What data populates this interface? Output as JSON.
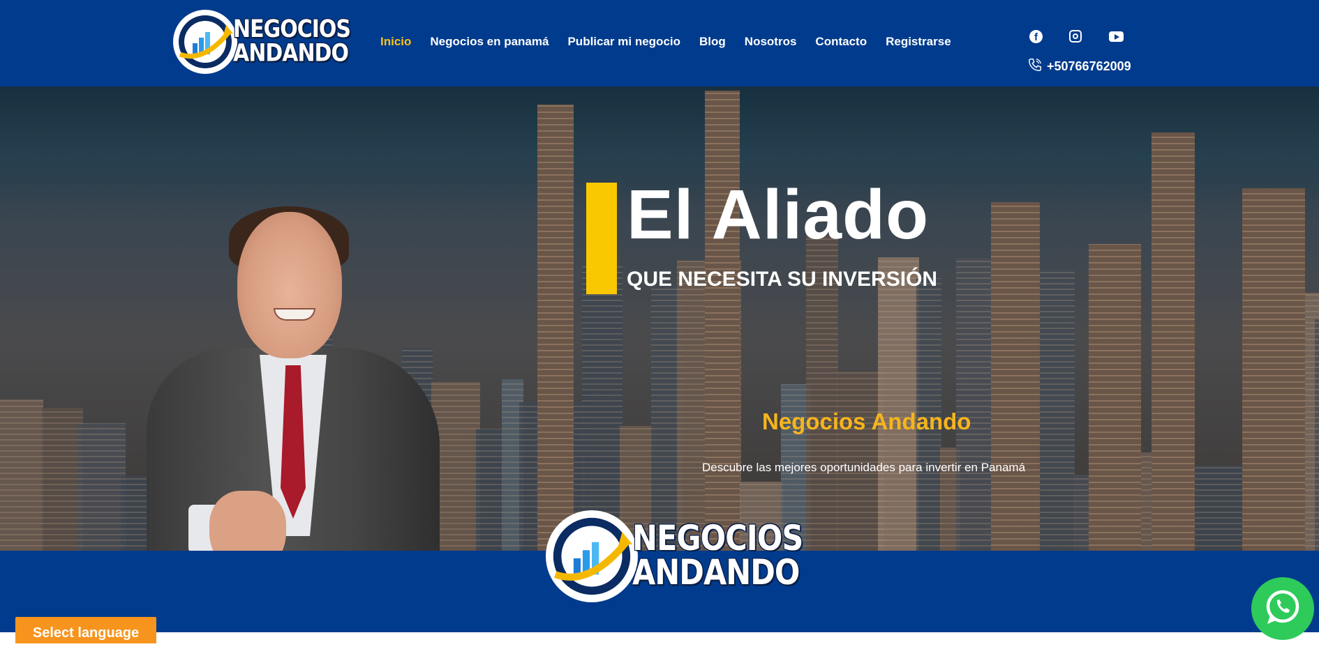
{
  "header": {
    "logo": {
      "line1": "NEGOCIOS",
      "line2": "ANDANDO"
    },
    "nav": [
      {
        "label": "Inicio",
        "active": true
      },
      {
        "label": "Negocios en panamá",
        "active": false
      },
      {
        "label": "Publicar mi negocio",
        "active": false
      },
      {
        "label": "Blog",
        "active": false
      },
      {
        "label": "Nosotros",
        "active": false
      },
      {
        "label": "Contacto",
        "active": false
      },
      {
        "label": "Registrarse",
        "active": false
      }
    ],
    "social_icons": [
      "facebook-icon",
      "instagram-icon",
      "youtube-icon"
    ],
    "phone": "+50766762009"
  },
  "hero": {
    "title": "El Aliado",
    "subtitle": "QUE NECESITA SU INVERSIÓN",
    "brand": "Negocios Andando",
    "description": "Descubre las mejores oportunidades para invertir en Panamá"
  },
  "band": {
    "logo": {
      "line1": "NEGOCIOS",
      "line2": "ANDANDO"
    }
  },
  "language_button": "Select language",
  "colors": {
    "header_bg": "#003b8d",
    "active_nav": "#f9c316",
    "accent": "#f9c800",
    "brand_text": "#f6b51c",
    "language_button": "#f7941d",
    "whatsapp": "#2ecb5a"
  }
}
